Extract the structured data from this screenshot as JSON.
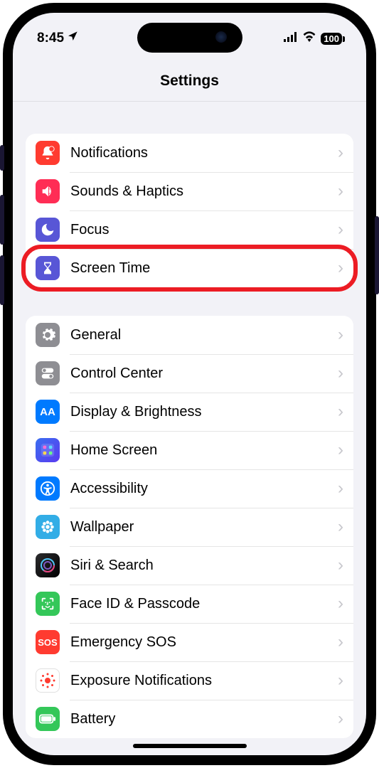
{
  "status": {
    "time": "8:45",
    "battery": "100"
  },
  "header": {
    "title": "Settings"
  },
  "groups": [
    {
      "items": [
        {
          "id": "notifications",
          "label": "Notifications",
          "icon": "bell-badge-icon",
          "bg": "bg-red"
        },
        {
          "id": "sounds-haptics",
          "label": "Sounds & Haptics",
          "icon": "speaker-wave-icon",
          "bg": "bg-pink"
        },
        {
          "id": "focus",
          "label": "Focus",
          "icon": "moon-icon",
          "bg": "bg-indigo"
        },
        {
          "id": "screen-time",
          "label": "Screen Time",
          "icon": "hourglass-icon",
          "bg": "bg-indigo",
          "highlighted": true
        }
      ]
    },
    {
      "items": [
        {
          "id": "general",
          "label": "General",
          "icon": "gear-icon",
          "bg": "bg-gray"
        },
        {
          "id": "control-center",
          "label": "Control Center",
          "icon": "switches-icon",
          "bg": "bg-gray"
        },
        {
          "id": "display-brightness",
          "label": "Display & Brightness",
          "icon": "aa-icon",
          "bg": "bg-blue"
        },
        {
          "id": "home-screen",
          "label": "Home Screen",
          "icon": "app-grid-icon",
          "bg": "bg-homescreen"
        },
        {
          "id": "accessibility",
          "label": "Accessibility",
          "icon": "accessibility-icon",
          "bg": "bg-blue"
        },
        {
          "id": "wallpaper",
          "label": "Wallpaper",
          "icon": "flower-icon",
          "bg": "bg-cyan"
        },
        {
          "id": "siri-search",
          "label": "Siri & Search",
          "icon": "siri-icon",
          "bg": "bg-dark"
        },
        {
          "id": "faceid-passcode",
          "label": "Face ID & Passcode",
          "icon": "faceid-icon",
          "bg": "bg-green"
        },
        {
          "id": "emergency-sos",
          "label": "Emergency SOS",
          "icon": "sos-icon",
          "bg": "bg-red"
        },
        {
          "id": "exposure-notifications",
          "label": "Exposure Notifications",
          "icon": "exposure-icon",
          "bg": "bg-white"
        },
        {
          "id": "battery",
          "label": "Battery",
          "icon": "battery-icon",
          "bg": "bg-green"
        }
      ]
    }
  ],
  "colors": {
    "highlight": "#ec1c24"
  }
}
